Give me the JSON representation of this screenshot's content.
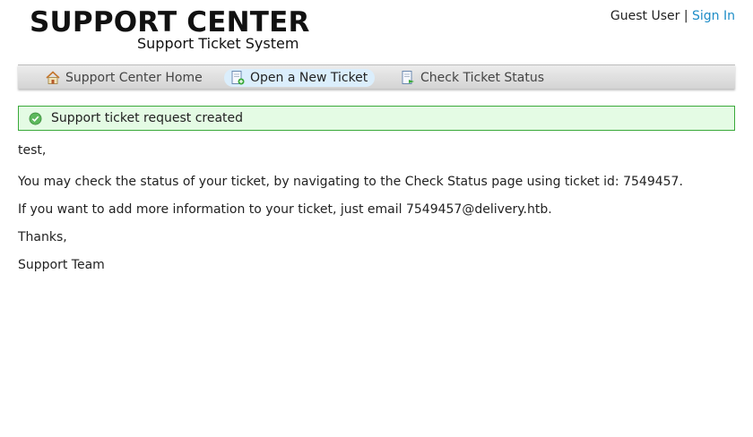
{
  "brand": {
    "title": "SUPPORT CENTER",
    "subtitle": "Support Ticket System"
  },
  "user": {
    "name": "Guest User",
    "separator": "|",
    "sign_in": "Sign In"
  },
  "nav": {
    "items": [
      {
        "label": "Support Center Home",
        "icon": "home-icon"
      },
      {
        "label": "Open a New Ticket",
        "icon": "new-ticket-icon",
        "active": true
      },
      {
        "label": "Check Ticket Status",
        "icon": "ticket-status-icon"
      }
    ]
  },
  "notice": {
    "message": "Support ticket request created",
    "icon": "check-circle-icon",
    "color": "#3aa93a"
  },
  "body": {
    "greeting": "test,",
    "line1": "You may check the status of your ticket, by navigating to the Check Status page using ticket id: 7549457.",
    "line2": "If you want to add more information to your ticket, just email 7549457@delivery.htb.",
    "thanks": "Thanks,",
    "signature": "Support Team"
  },
  "colors": {
    "link": "#1e8dc7",
    "active_tab": "#dbeefc",
    "notice_bg": "#e4fbe4"
  }
}
